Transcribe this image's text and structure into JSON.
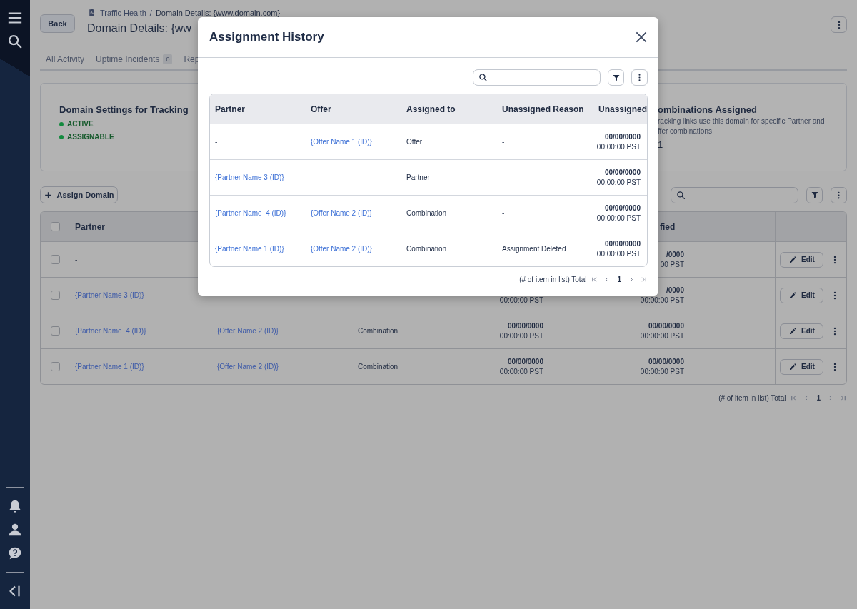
{
  "header": {
    "back": "Back",
    "breadcrumb": [
      "Traffic Health",
      "Domain Details: {www.domain.com}"
    ],
    "breadcrumb_separator": "/",
    "title": "Domain Details: {ww"
  },
  "tabs": [
    {
      "label": "All Activity",
      "selected": false
    },
    {
      "label": "Uptime Incidents",
      "badge": "0",
      "selected": false
    },
    {
      "label": "Rep",
      "selected": false
    }
  ],
  "settings_card": {
    "title": "Domain Settings for Tracking",
    "statuses": [
      "ACTIVE",
      "ASSIGNABLE"
    ]
  },
  "combinations_card": {
    "title": "ombinations Assigned",
    "description_lines": [
      "racking links use this domain for specific Partner and",
      "ffer combinations"
    ],
    "value": "1"
  },
  "assign_button": "Assign Domain",
  "table": {
    "header_checked": false,
    "columns": [
      "Partner",
      "fied"
    ],
    "rows": [
      {
        "checked": false,
        "partner": {
          "kind": "text",
          "text": "-"
        },
        "col4": null,
        "col5": {
          "date": "/0000",
          "time": "00 PST"
        },
        "edit": "Edit"
      },
      {
        "checked": false,
        "partner": {
          "kind": "link",
          "text": "{Partner Name 3 (ID)}"
        },
        "col4": {
          "time": "00:00:00 PST"
        },
        "col5": {
          "date": "/0000",
          "time": "00:00:00 PST"
        },
        "edit": "Edit"
      },
      {
        "checked": false,
        "partner": {
          "kind": "link",
          "text": "{Partner Name  4 (ID)}"
        },
        "offer": {
          "kind": "link",
          "text": "{Offer Name 2 (ID)}"
        },
        "assigned": "Combination",
        "col4": {
          "date": "00/00/0000",
          "time": "00:00:00 PST"
        },
        "col5": {
          "date": "00/00/0000",
          "time": "00:00:00 PST"
        },
        "edit": "Edit"
      },
      {
        "checked": false,
        "partner": {
          "kind": "link",
          "text": "{Partner Name 1 (ID)}"
        },
        "offer": {
          "kind": "link",
          "text": "{Offer Name 2 (ID)}"
        },
        "assigned": "Combination",
        "col4": {
          "date": "00/00/0000",
          "time": "00:00:00 PST"
        },
        "col5": {
          "date": "00/00/0000",
          "time": "00:00:00 PST"
        },
        "edit": "Edit"
      }
    ]
  },
  "pagination": {
    "summary": "(# of item in list) Total",
    "page": "1"
  },
  "modal": {
    "title": "Assignment History",
    "columns": [
      "Partner",
      "Offer",
      "Assigned to",
      "Unassigned Reason",
      "Unassigned"
    ],
    "rows": [
      {
        "partner": {
          "kind": "text",
          "text": "-"
        },
        "offer": {
          "kind": "link",
          "text": "{Offer Name 1 (ID)}"
        },
        "assigned_to": "Offer",
        "reason": "-",
        "unassigned": {
          "date": "00/00/0000",
          "time": "00:00:00 PST"
        }
      },
      {
        "partner": {
          "kind": "link",
          "text": "{Partner Name 3 (ID)}"
        },
        "offer": {
          "kind": "text",
          "text": "-"
        },
        "assigned_to": "Partner",
        "reason": "-",
        "unassigned": {
          "date": "00/00/0000",
          "time": "00:00:00 PST"
        }
      },
      {
        "partner": {
          "kind": "link",
          "text": "{Partner Name  4 (ID)}"
        },
        "offer": {
          "kind": "link",
          "text": "{Offer Name 2 (ID)}"
        },
        "assigned_to": "Combination",
        "reason": "-",
        "unassigned": {
          "date": "00/00/0000",
          "time": "00:00:00 PST"
        }
      },
      {
        "partner": {
          "kind": "link",
          "text": "{Partner Name 1 (ID)}"
        },
        "offer": {
          "kind": "link",
          "text": "{Offer Name 2 (ID)}"
        },
        "assigned_to": "Combination",
        "reason": "Assignment Deleted",
        "unassigned": {
          "date": "00/00/0000",
          "time": "00:00:00 PST"
        }
      }
    ],
    "pagination": {
      "summary": "(# of item in list) Total",
      "page": "1"
    }
  }
}
